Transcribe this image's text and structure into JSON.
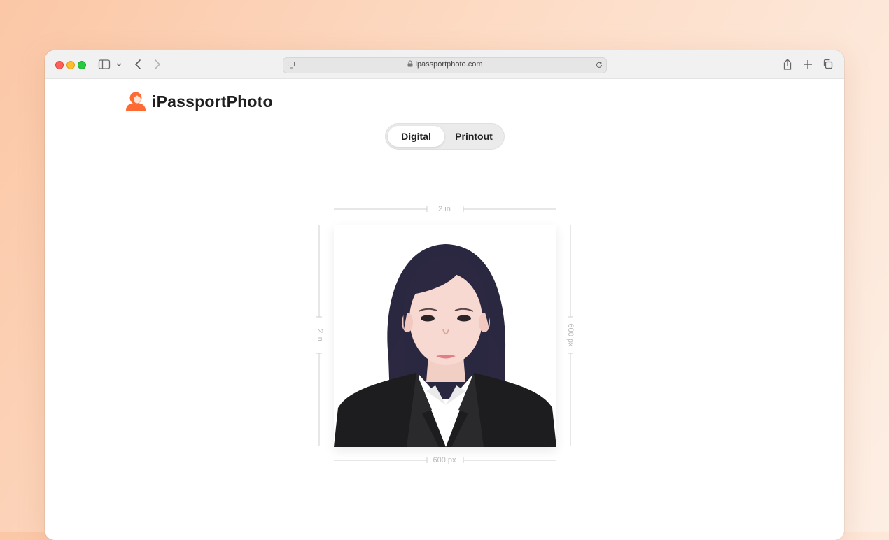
{
  "browser": {
    "url": "ipassportphoto.com"
  },
  "brand": {
    "name": "iPassportPhoto",
    "accent": "#fd6a33"
  },
  "mode_toggle": {
    "options": [
      "Digital",
      "Printout"
    ],
    "selected": "Digital"
  },
  "photo": {
    "width_in_label": "2 in",
    "height_in_label": "2 in",
    "width_px_label": "600 px",
    "height_px_label": "600 px"
  }
}
